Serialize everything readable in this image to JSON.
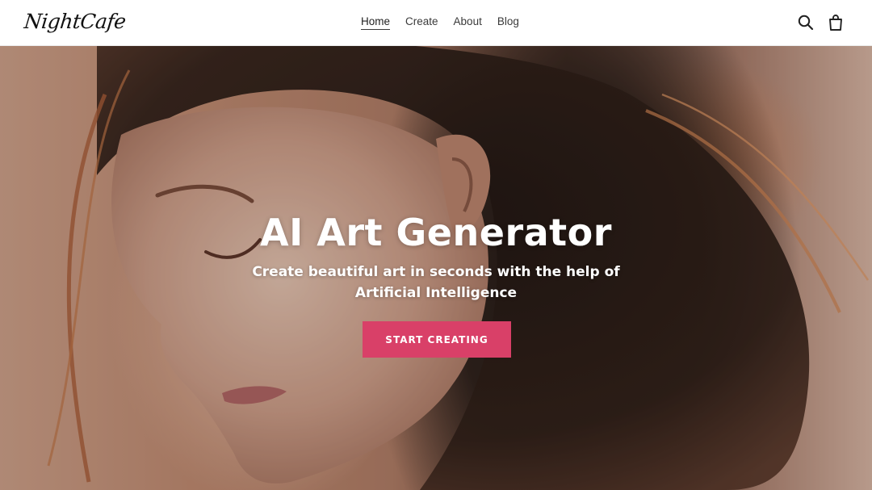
{
  "header": {
    "logo": "NightCafe",
    "nav": [
      "Home",
      "Create",
      "About",
      "Blog"
    ],
    "active_nav": "Home",
    "icons": [
      "search-icon",
      "cart-icon"
    ]
  },
  "hero": {
    "title": "AI Art Generator",
    "subtitle": "Create beautiful art in seconds with the help of Artificial Intelligence",
    "cta_label": "START CREATING"
  },
  "colors": {
    "accent": "#d94068",
    "header_bg": "#ffffff",
    "text_dark": "#111111"
  }
}
